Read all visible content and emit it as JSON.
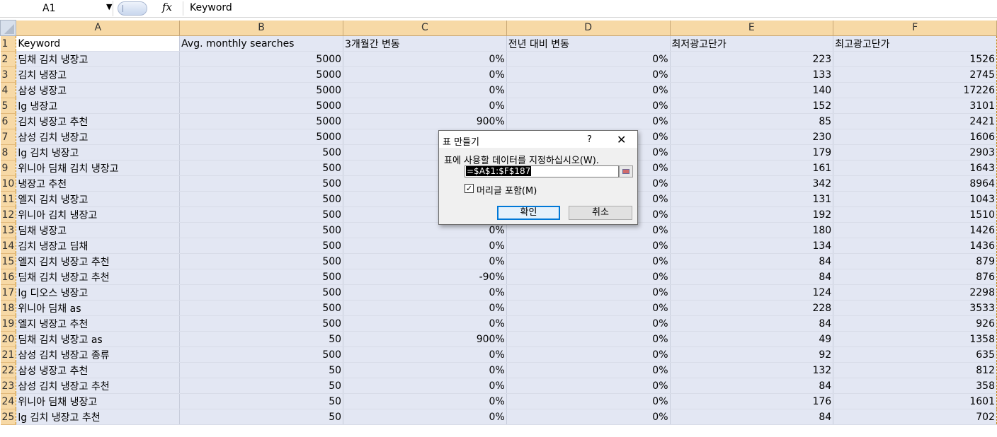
{
  "formula_bar": {
    "name_box": "A1",
    "fx_symbol": "fx",
    "value": "Keyword"
  },
  "sheet": {
    "columns": [
      "A",
      "B",
      "C",
      "D",
      "E",
      "F"
    ],
    "header": [
      "Keyword",
      "Avg. monthly searches",
      "3개월간 변동",
      "전년 대비 변동",
      "최저광고단가",
      "최고광고단가"
    ],
    "rows": [
      [
        "2",
        "딤채 김치 냉장고",
        "5000",
        "0%",
        "0%",
        "223",
        "1526"
      ],
      [
        "3",
        "김치 냉장고",
        "5000",
        "0%",
        "0%",
        "133",
        "2745"
      ],
      [
        "4",
        "삼성 냉장고",
        "5000",
        "0%",
        "0%",
        "140",
        "17226"
      ],
      [
        "5",
        "lg 냉장고",
        "5000",
        "0%",
        "0%",
        "152",
        "3101"
      ],
      [
        "6",
        "김치 냉장고 추천",
        "5000",
        "900%",
        "0%",
        "85",
        "2421"
      ],
      [
        "7",
        "삼성 김치 냉장고",
        "5000",
        "",
        "0%",
        "230",
        "1606"
      ],
      [
        "8",
        "lg 김치 냉장고",
        "500",
        "",
        "0%",
        "179",
        "2903"
      ],
      [
        "9",
        "위니아 딤채 김치 냉장고",
        "500",
        "",
        "0%",
        "161",
        "1643"
      ],
      [
        "10",
        "냉장고 추천",
        "500",
        "",
        "0%",
        "342",
        "8964"
      ],
      [
        "11",
        "엘지 김치 냉장고",
        "500",
        "",
        "0%",
        "131",
        "1043"
      ],
      [
        "12",
        "위니아 김치 냉장고",
        "500",
        "0%",
        "0%",
        "192",
        "1510"
      ],
      [
        "13",
        "딤채 냉장고",
        "500",
        "0%",
        "0%",
        "180",
        "1426"
      ],
      [
        "14",
        "김치 냉장고 딤채",
        "500",
        "0%",
        "0%",
        "134",
        "1436"
      ],
      [
        "15",
        "엘지 김치 냉장고 추천",
        "500",
        "0%",
        "0%",
        "84",
        "879"
      ],
      [
        "16",
        "딤채 김치 냉장고 추천",
        "500",
        "-90%",
        "0%",
        "84",
        "876"
      ],
      [
        "17",
        "lg 디오스 냉장고",
        "500",
        "0%",
        "0%",
        "124",
        "2298"
      ],
      [
        "18",
        "위니아 딤채 as",
        "500",
        "0%",
        "0%",
        "228",
        "3533"
      ],
      [
        "19",
        "엘지 냉장고 추천",
        "500",
        "0%",
        "0%",
        "84",
        "926"
      ],
      [
        "20",
        "딤채 김치 냉장고 as",
        "50",
        "900%",
        "0%",
        "49",
        "1358"
      ],
      [
        "21",
        "삼성 김치 냉장고 종류",
        "500",
        "0%",
        "0%",
        "92",
        "635"
      ],
      [
        "22",
        "삼성 냉장고 추천",
        "50",
        "0%",
        "0%",
        "132",
        "812"
      ],
      [
        "23",
        "삼성 김치 냉장고 추천",
        "50",
        "0%",
        "0%",
        "84",
        "358"
      ],
      [
        "24",
        "위니아 딤채 냉장고",
        "50",
        "0%",
        "0%",
        "176",
        "1601"
      ],
      [
        "25",
        "lg 김치 냉장고 추천",
        "50",
        "0%",
        "0%",
        "84",
        "702"
      ]
    ]
  },
  "dialog": {
    "title": "표 만들기",
    "help": "?",
    "close": "✕",
    "prompt": "표에 사용할 데이터를 지정하십시오(W).",
    "range": "=$A$1:$F$187",
    "checkbox_checked": true,
    "checkbox_mark": "✓",
    "checkbox_label": "머리글 포함(M)",
    "ok_label": "확인",
    "cancel_label": "취소"
  }
}
